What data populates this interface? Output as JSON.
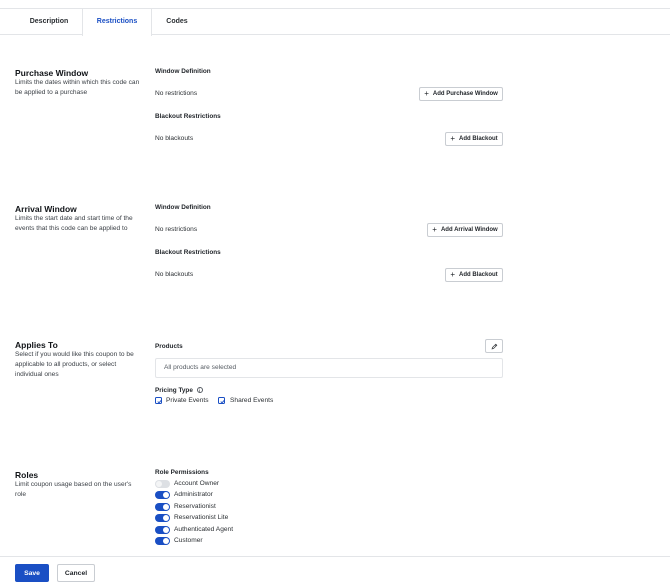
{
  "tabs": [
    {
      "label": "Description",
      "active": false
    },
    {
      "label": "Restrictions",
      "active": true
    },
    {
      "label": "Codes",
      "active": false
    }
  ],
  "purchase_window": {
    "title": "Purchase Window",
    "description": "Limits the dates within which this code can be applied to a purchase",
    "window_definition_label": "Window Definition",
    "window_value": "No restrictions",
    "add_window_label": "Add Purchase Window",
    "blackout_label": "Blackout Restrictions",
    "blackout_value": "No blackouts",
    "add_blackout_label": "Add Blackout"
  },
  "arrival_window": {
    "title": "Arrival Window",
    "description": "Limits the start date and start time of the events that this code can be applied to",
    "window_definition_label": "Window Definition",
    "window_value": "No restrictions",
    "add_window_label": "Add Arrival Window",
    "blackout_label": "Blackout Restrictions",
    "blackout_value": "No blackouts",
    "add_blackout_label": "Add Blackout"
  },
  "applies_to": {
    "title": "Applies To",
    "description": "Select if you would like this coupon to be applicable to all products, or select individual ones",
    "products_label": "Products",
    "products_value": "All products are selected",
    "pricing_type_label": "Pricing Type",
    "pricing_options": [
      {
        "label": "Private Events",
        "checked": true
      },
      {
        "label": "Shared Events",
        "checked": true
      }
    ]
  },
  "roles": {
    "title": "Roles",
    "description": "Limit coupon usage based on the user's role",
    "permissions_label": "Role Permissions",
    "items": [
      {
        "label": "Account Owner",
        "enabled": false
      },
      {
        "label": "Administrator",
        "enabled": true
      },
      {
        "label": "Reservationist",
        "enabled": true
      },
      {
        "label": "Reservationist Lite",
        "enabled": true
      },
      {
        "label": "Authenticated Agent",
        "enabled": true
      },
      {
        "label": "Customer",
        "enabled": true
      }
    ]
  },
  "footer": {
    "save_label": "Save",
    "cancel_label": "Cancel"
  },
  "colors": {
    "accent": "#1a4fc4",
    "border": "#e3e5e8"
  }
}
